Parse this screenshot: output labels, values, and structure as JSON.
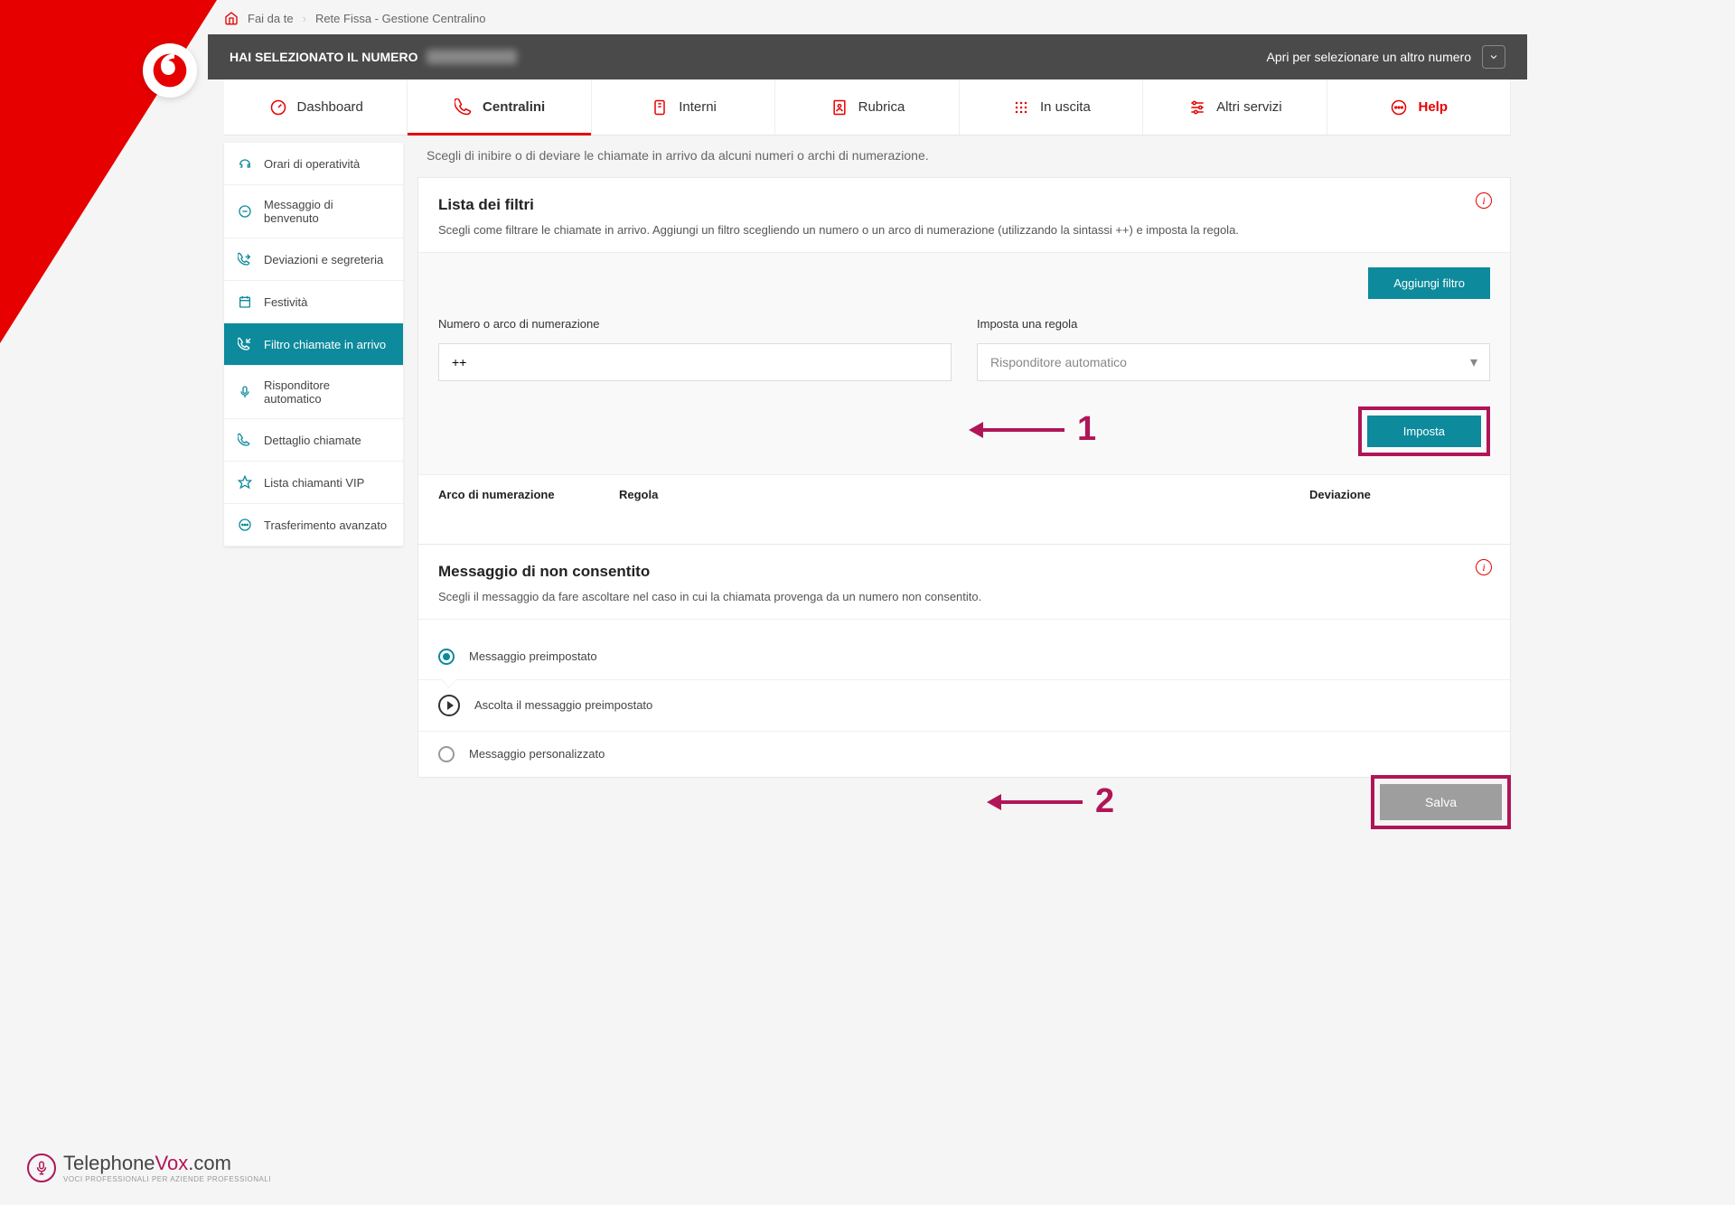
{
  "breadcrumb": {
    "home": "Fai da te",
    "page": "Rete Fissa - Gestione Centralino"
  },
  "header": {
    "label": "HAI SELEZIONATO IL NUMERO",
    "right": "Apri per selezionare un altro numero"
  },
  "tabs": {
    "dashboard": "Dashboard",
    "centralini": "Centralini",
    "interni": "Interni",
    "rubrica": "Rubrica",
    "uscita": "In uscita",
    "servizi": "Altri servizi",
    "help": "Help"
  },
  "intro": "Scegli di inibire o di deviare le chiamate in arrivo da alcuni numeri o archi di numerazione.",
  "sideMenu": {
    "orari": "Orari di operatività",
    "benvenuto": "Messaggio di benvenuto",
    "deviazioni": "Deviazioni e segreteria",
    "festivita": "Festività",
    "filtro": "Filtro chiamate in arrivo",
    "risponditore": "Risponditore automatico",
    "dettaglio": "Dettaglio chiamate",
    "vip": "Lista chiamanti VIP",
    "trasferimento": "Trasferimento avanzato"
  },
  "filters": {
    "title": "Lista dei filtri",
    "desc": "Scegli come filtrare le chiamate in arrivo. Aggiungi un filtro scegliendo un numero o un arco di numerazione (utilizzando la sintassi ++) e imposta la regola.",
    "addBtn": "Aggiungi filtro",
    "numLabel": "Numero o arco di numerazione",
    "numValue": "++",
    "ruleLabel": "Imposta una regola",
    "ruleValue": "Risponditore automatico",
    "impostaBtn": "Imposta",
    "tableCols": {
      "c1": "Arco di numerazione",
      "c2": "Regola",
      "c3": "Deviazione"
    }
  },
  "msg": {
    "title": "Messaggio di non consentito",
    "desc": "Scegli il messaggio da fare ascoltare nel caso in cui la chiamata provenga da un numero non consentito.",
    "opt1": "Messaggio preimpostato",
    "play": "Ascolta il messaggio preimpostato",
    "opt2": "Messaggio personalizzato"
  },
  "salva": "Salva",
  "annotations": {
    "n1": "1",
    "n2": "2"
  },
  "footer": {
    "brand1": "Telephone",
    "brand2": "Vox",
    "brand3": ".com",
    "tag": "VOCI PROFESSIONALI PER AZIENDE PROFESSIONALI"
  }
}
